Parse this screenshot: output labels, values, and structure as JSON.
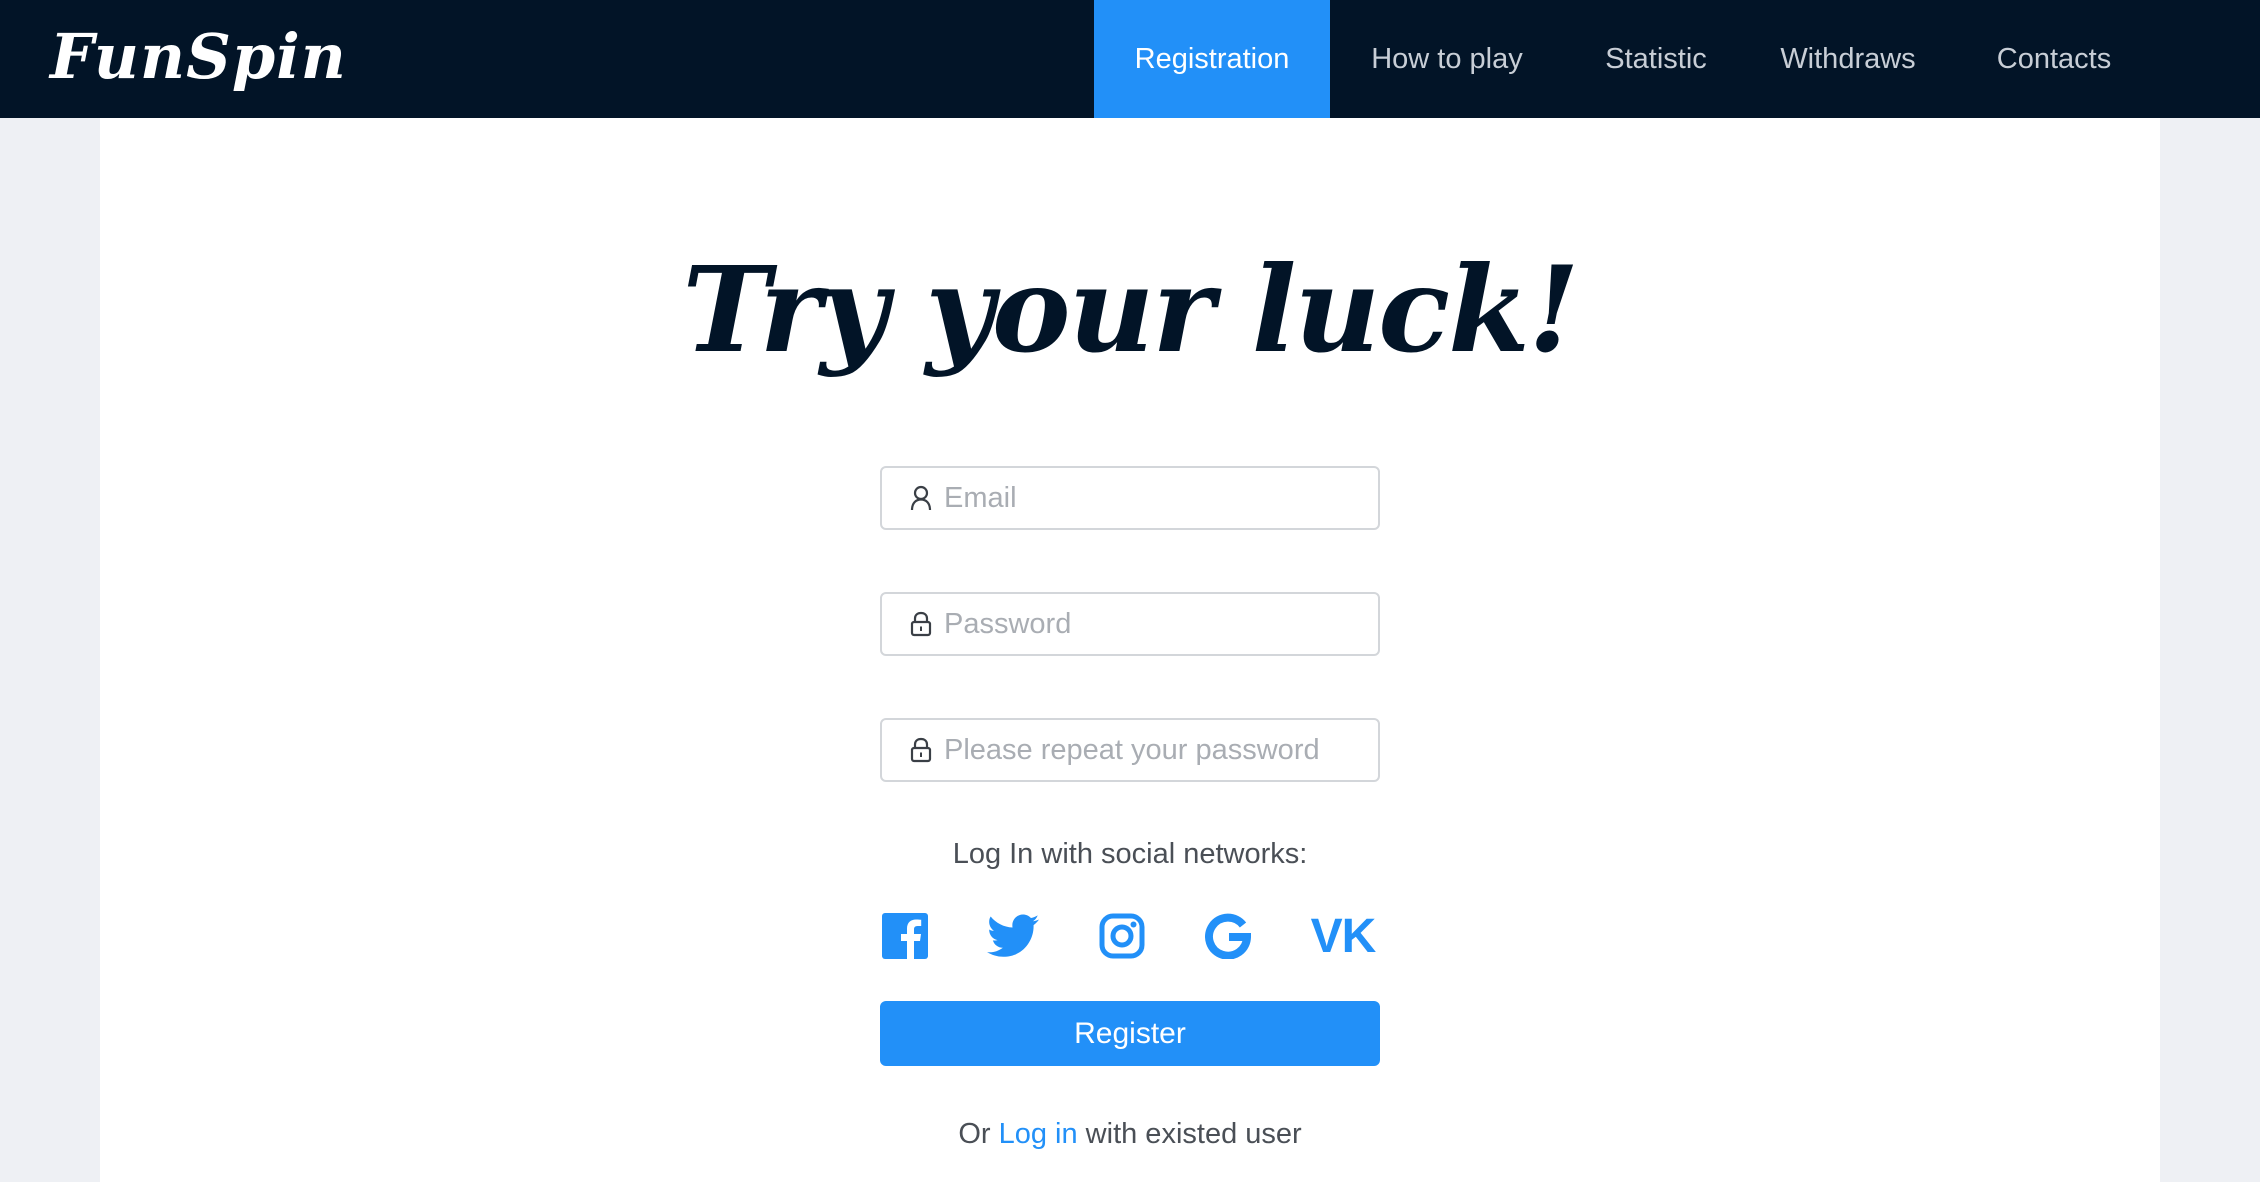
{
  "header": {
    "logo": "FunSpin",
    "nav": [
      {
        "label": "Registration",
        "active": true
      },
      {
        "label": "How to play",
        "active": false
      },
      {
        "label": "Statistic",
        "active": false
      },
      {
        "label": "Withdraws",
        "active": false
      },
      {
        "label": "Contacts",
        "active": false
      }
    ]
  },
  "main": {
    "headline": "Try your luck!",
    "form": {
      "email_placeholder": "Email",
      "password_placeholder": "Password",
      "repeat_password_placeholder": "Please repeat your password",
      "email_value": "",
      "password_value": "",
      "repeat_password_value": ""
    },
    "social_label": "Log In with social networks:",
    "socials": [
      {
        "name": "facebook-icon"
      },
      {
        "name": "twitter-icon"
      },
      {
        "name": "instagram-icon"
      },
      {
        "name": "google-icon"
      },
      {
        "name": "vk-icon",
        "label": "VK"
      }
    ],
    "register_label": "Register",
    "alt_prefix": "Or ",
    "alt_link": "Log in",
    "alt_suffix": " with existed user"
  },
  "colors": {
    "header_bg": "#021427",
    "accent": "#2290f8",
    "page_bg": "#eef0f4",
    "headline": "#021427"
  }
}
